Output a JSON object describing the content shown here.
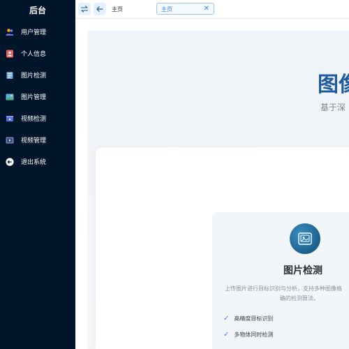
{
  "sidebar": {
    "title": "后台",
    "items": [
      {
        "label": "用户管理",
        "icon": "users-icon"
      },
      {
        "label": "个人信息",
        "icon": "id-card-icon"
      },
      {
        "label": "图片检测",
        "icon": "image-detect-icon"
      },
      {
        "label": "图片管理",
        "icon": "image-manage-icon"
      },
      {
        "label": "视频检测",
        "icon": "video-detect-icon"
      },
      {
        "label": "视频管理",
        "icon": "video-manage-icon"
      },
      {
        "label": "退出系统",
        "icon": "logout-icon"
      }
    ]
  },
  "topbar": {
    "breadcrumb": "主页",
    "tab_label": "主页",
    "tab_close": "✕",
    "toggle_icon": "collapse-toggle-icon",
    "back_icon": "back-arrow-icon"
  },
  "hero": {
    "title": "图像",
    "subtitle": "基于深"
  },
  "feature": {
    "title": "图片检测",
    "desc_line1": "上传图片进行目标识别与分析，支持多种图像格",
    "desc_line2": "确的检测算法。",
    "items": [
      "高精度目标识别",
      "多物体同时检测"
    ]
  },
  "colors": {
    "sidebar_bg": "#001529",
    "accent": "#3b82f6",
    "hero_title": "#1e5aa0"
  }
}
